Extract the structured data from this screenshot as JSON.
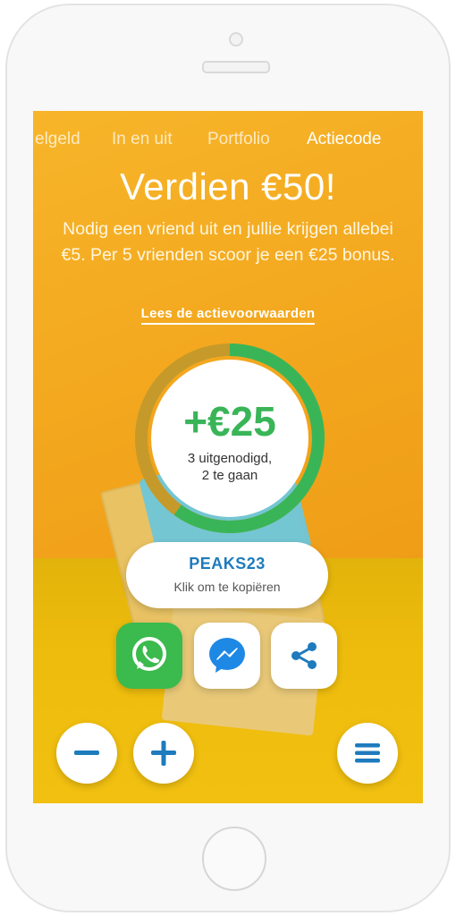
{
  "tabs": [
    {
      "label": "elgeld",
      "active": false
    },
    {
      "label": "In en uit",
      "active": false
    },
    {
      "label": "Portfolio",
      "active": false
    },
    {
      "label": "Actiecode",
      "active": true
    }
  ],
  "headline": "Verdien €50!",
  "description": "Nodig een vriend uit en jullie krijgen allebei €5. Per 5 vrienden scoor je een €25 bonus.",
  "terms_link": "Lees de actievoorwaarden",
  "progress": {
    "amount": "+€25",
    "line1": "3 uitgenodigd,",
    "line2": "2 te gaan",
    "invited": 3,
    "goal": 5,
    "fraction": 0.6
  },
  "promo": {
    "code": "PEAKS23",
    "hint": "Klik om te kopiëren"
  },
  "share": {
    "whatsapp_icon": "whatsapp-icon",
    "messenger_icon": "messenger-icon",
    "share_icon": "share-icon"
  },
  "controls": {
    "minus_icon": "minus-icon",
    "plus_icon": "plus-icon",
    "menu_icon": "hamburger-menu-icon"
  },
  "colors": {
    "background": "#f2a51c",
    "progress_green": "#39b558",
    "progress_track": "#c59a2a",
    "link_blue": "#1e7bbd",
    "whatsapp_green": "#3bba4d",
    "messenger_blue": "#1e88e5"
  }
}
